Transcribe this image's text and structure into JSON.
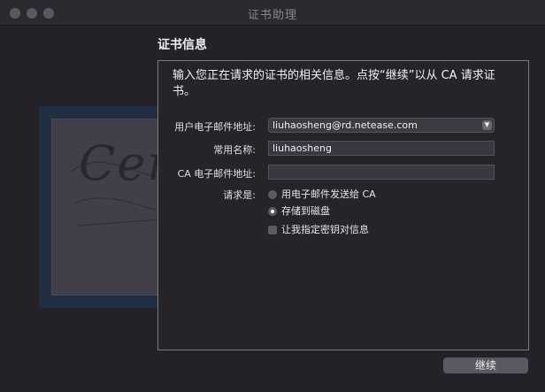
{
  "window": {
    "title": "证书助理"
  },
  "section": {
    "title": "证书信息"
  },
  "intro": "输入您正在请求的证书的相关信息。点按“继续”以从 CA 请求证书。",
  "form": {
    "email_label": "用户电子邮件地址:",
    "email_value": "liuhaosheng@rd.netease.com",
    "common_name_label": "常用名称:",
    "common_name_value": "liuhaosheng",
    "ca_email_label": "CA 电子邮件地址:",
    "ca_email_value": "",
    "request_label": "请求是:",
    "option_email": "用电子邮件发送给 CA",
    "option_disk": "存储到磁盘",
    "option_selected": "disk",
    "key_pair_label": "让我指定密钥对信息",
    "key_pair_checked": false
  },
  "buttons": {
    "continue_label": "继续"
  },
  "decor": {
    "certificate_text": "Certificate"
  }
}
